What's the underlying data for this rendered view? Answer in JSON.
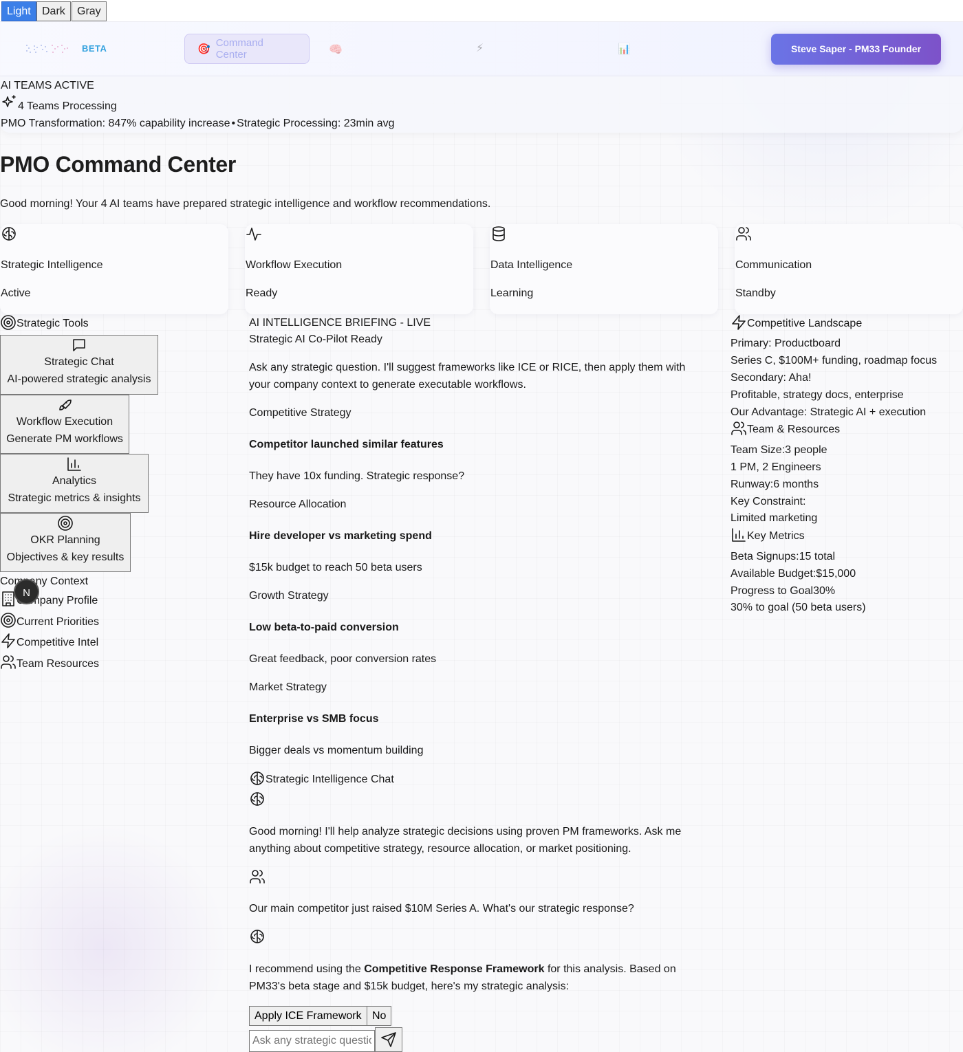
{
  "theme": {
    "options": [
      "Light",
      "Dark",
      "Gray"
    ],
    "selected": "Light",
    "accent": "#3b7fe8"
  },
  "nav": {
    "beta": "BETA",
    "tabs": [
      {
        "label": "Command Center",
        "icon": "target-icon",
        "active": true
      }
    ],
    "user_button": "Steve Saper - PM33 Founder",
    "brand_gradient": [
      "#6a74e6",
      "#7d52c9"
    ]
  },
  "status": {
    "heading": "AI TEAMS ACTIVE",
    "teams_processing": "4 Teams Processing",
    "transformation": "PMO Transformation: 847% capability increase",
    "separator": "•",
    "processing": "Strategic Processing: 23min avg"
  },
  "page": {
    "title": "PMO Command Center",
    "subtitle": "Good morning! Your 4 AI teams have prepared strategic intelligence and workflow recommendations."
  },
  "teams": [
    {
      "name": "Strategic Intelligence",
      "state": "Active",
      "icon": "brain-icon"
    },
    {
      "name": "Workflow Execution",
      "state": "Ready",
      "icon": "activity-icon"
    },
    {
      "name": "Data Intelligence",
      "state": "Learning",
      "icon": "database-icon"
    },
    {
      "name": "Communication",
      "state": "Standby",
      "icon": "users-icon"
    }
  ],
  "tools": {
    "heading": "Strategic Tools",
    "items": [
      {
        "title": "Strategic Chat",
        "desc": "AI-powered strategic analysis",
        "icon": "message-icon"
      },
      {
        "title": "Workflow Execution",
        "desc": "Generate PM workflows",
        "icon": "rocket-icon"
      },
      {
        "title": "Analytics",
        "desc": "Strategic metrics & insights",
        "icon": "bar-chart-icon"
      },
      {
        "title": "OKR Planning",
        "desc": "Objectives & key results",
        "icon": "target-icon"
      }
    ]
  },
  "context": {
    "heading": "Company Context",
    "items": [
      "Company Profile",
      "Current Priorities",
      "Competitive Intel",
      "Team Resources"
    ],
    "avatar_letter": "N"
  },
  "briefing": {
    "heading": "AI INTELLIGENCE BRIEFING - LIVE",
    "ready": "Strategic AI Co-Pilot Ready",
    "intro": "Ask any strategic question. I'll suggest frameworks like ICE or RICE, then apply them with your company context to generate executable workflows.",
    "scenarios": [
      {
        "category": "Competitive Strategy",
        "title": "Competitor launched similar features",
        "desc": "They have 10x funding. Strategic response?"
      },
      {
        "category": "Resource Allocation",
        "title": "Hire developer vs marketing spend",
        "desc": "$15k budget to reach 50 beta users"
      },
      {
        "category": "Growth Strategy",
        "title": "Low beta-to-paid conversion",
        "desc": "Great feedback, poor conversion rates"
      },
      {
        "category": "Market Strategy",
        "title": "Enterprise vs SMB focus",
        "desc": "Bigger deals vs momentum building"
      }
    ]
  },
  "chat": {
    "title": "Strategic Intelligence Chat",
    "messages": [
      {
        "role": "ai",
        "text": "Good morning! I'll help analyze strategic decisions using proven PM frameworks. Ask me anything about competitive strategy, resource allocation, or market positioning."
      },
      {
        "role": "user",
        "text": "Our main competitor just raised $10M Series A. What's our strategic response?"
      },
      {
        "role": "ai",
        "pre": "I recommend using the ",
        "strong": "Competitive Response Framework",
        "post": " for this analysis. Based on PM33's beta stage and $15k budget, here's my strategic analysis:"
      }
    ],
    "apply_button": "Apply ICE Framework",
    "no_button": "No",
    "input_placeholder": "Ask any strategic question..."
  },
  "right": {
    "landscape": {
      "heading": "Competitive Landscape",
      "primary": "Primary: Productboard",
      "primary_desc": "Series C, $100M+ funding, roadmap focus",
      "secondary": "Secondary: Aha!",
      "secondary_desc": "Profitable, strategy docs, enterprise",
      "advantage": "Our Advantage: Strategic AI + execution"
    },
    "team": {
      "heading": "Team & Resources",
      "size_label": "Team Size:",
      "size_value": "3 people",
      "composition": "1 PM, 2 Engineers",
      "runway_label": "Runway:",
      "runway_value": "6 months",
      "constraint_label": "Key Constraint:",
      "constraint_value": "Limited marketing"
    },
    "metrics": {
      "heading": "Key Metrics",
      "signups_label": "Beta Signups:",
      "signups_value": "15 total",
      "budget_label": "Available Budget:",
      "budget_value": "$15,000",
      "progress_label": "Progress to Goal",
      "progress_value": "30%",
      "progress_note": "30% to goal (50 beta users)"
    }
  }
}
